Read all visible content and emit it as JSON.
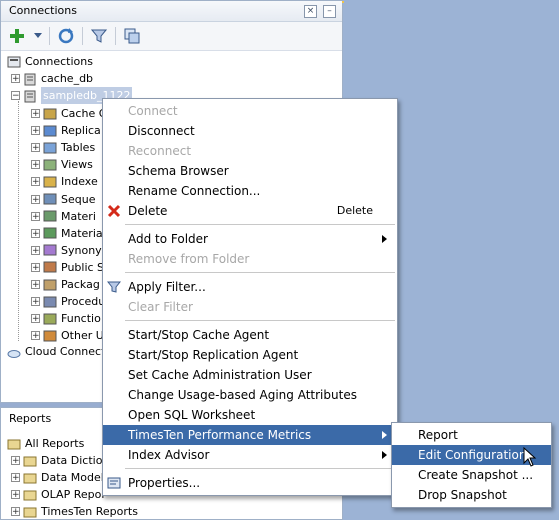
{
  "connections_panel": {
    "title": "Connections",
    "tree": {
      "root": "Connections",
      "nodes": [
        "cache_db",
        "sampledb_1122"
      ],
      "children": [
        "Cache G",
        "Replica",
        "Tables",
        "Views",
        "Indexe",
        "Seque",
        "Materi",
        "Materia",
        "Synony",
        "Public S",
        "Packag",
        "Procedu",
        "Functio",
        "Other U"
      ],
      "cloud": "Cloud Connectio"
    }
  },
  "reports_panel": {
    "title": "Reports",
    "root": "All Reports",
    "items": [
      "Data Dictio",
      "Data Model",
      "OLAP Repor",
      "TimesTen Reports"
    ]
  },
  "context_menu": {
    "connect": "Connect",
    "disconnect": "Disconnect",
    "reconnect": "Reconnect",
    "schema_browser": "Schema Browser",
    "rename_connection": "Rename Connection...",
    "delete": "Delete",
    "delete_accel": "Delete",
    "add_to_folder": "Add to Folder",
    "remove_from_folder": "Remove from Folder",
    "apply_filter": "Apply Filter...",
    "clear_filter": "Clear Filter",
    "start_stop_cache_agent": "Start/Stop Cache Agent",
    "start_stop_replication_agent": "Start/Stop Replication Agent",
    "set_cache_admin_user": "Set Cache Administration User",
    "change_aging": "Change Usage-based Aging Attributes",
    "open_sql_worksheet": "Open SQL Worksheet",
    "timesten_perf_metrics": "TimesTen Performance Metrics",
    "index_advisor": "Index Advisor",
    "properties": "Properties..."
  },
  "submenu": {
    "report": "Report",
    "edit_configuration": "Edit Configuration",
    "create_snapshot": "Create Snapshot ...",
    "drop_snapshot": "Drop Snapshot"
  },
  "colors": {
    "highlight": "#3b6aa8",
    "disabled": "#a7a7a7",
    "desktop": "#9cb3d5"
  }
}
